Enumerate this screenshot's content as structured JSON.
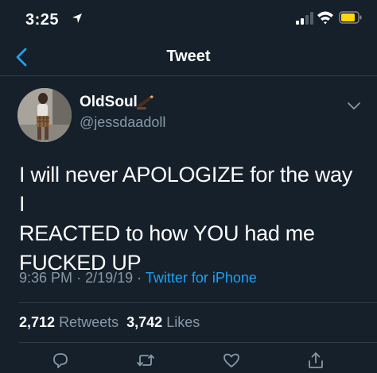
{
  "status_bar": {
    "time": "3:25"
  },
  "nav": {
    "title": "Tweet"
  },
  "author": {
    "display_name": "OldSoul",
    "handle": "@jessdaadoll",
    "name_emoji": "writing-hand-emoji"
  },
  "tweet": {
    "text": "I will never APOLOGIZE for the way I\nREACTED to how YOU had me\nFUCKED UP",
    "time": "9:36 PM",
    "date": "2/19/19",
    "separator": "·",
    "source": "Twitter for iPhone"
  },
  "stats": {
    "retweets_count": "2,712",
    "retweets_label": "Retweets",
    "likes_count": "3,742",
    "likes_label": "Likes"
  },
  "colors": {
    "background": "#15202b",
    "accent": "#1da1f2",
    "secondary_text": "#8899a6",
    "divider": "#2f3d4a"
  },
  "icons": [
    "location-arrow-icon",
    "signal-icon",
    "wifi-icon",
    "battery-icon",
    "back-chevron-icon",
    "caret-down-icon",
    "reply-icon",
    "retweet-icon",
    "like-icon",
    "share-icon"
  ]
}
